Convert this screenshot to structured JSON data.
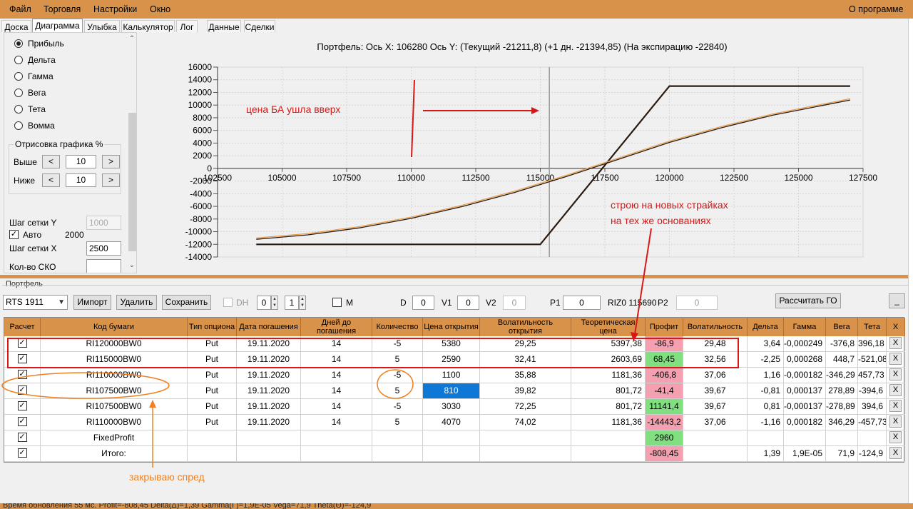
{
  "menu": {
    "file": "Файл",
    "trade": "Торговля",
    "settings": "Настройки",
    "window": "Окно",
    "about": "О программе"
  },
  "tabs": [
    "Доска",
    "Диаграмма",
    "Улыбка",
    "Калькулятор",
    "Лог",
    "Данные",
    "Сделки"
  ],
  "left_panel": {
    "radios": [
      "Прибыль",
      "Дельта",
      "Гамма",
      "Вега",
      "Тета",
      "Вомма"
    ],
    "selected_radio": "Прибыль",
    "group_title": "Отрисовка графика %",
    "above_label": "Выше",
    "above_value": "10",
    "below_label": "Ниже",
    "below_value": "10",
    "grid_y_label": "Шаг сетки Y",
    "grid_y_value": "1000",
    "auto_label": "Авто",
    "auto_value": "2000",
    "grid_x_label": "Шаг сетки X",
    "grid_x_value": "2500",
    "sko_label": "Кол-во СКО",
    "sko_value": ""
  },
  "chart": {
    "title": "Портфель: Ось X: 106280 Ось Y:  (Текущий -21211,8)  (+1 дн. -21394,85)  (На экспирацию -22840)",
    "annotation_up": "цена БА ушла вверх",
    "annotation_strikes_1": "строю  на новых страйках",
    "annotation_strikes_2": "на тех же основаниях"
  },
  "chart_data": {
    "type": "line",
    "title": "Портфель: Ось X: 106280 Ось Y:  (Текущий -21211,8)  (+1 дн. -21394,85)  (На экспирацию -22840)",
    "xlim": [
      102500,
      127500
    ],
    "ylim": [
      -14000,
      16000
    ],
    "x_ticks": [
      102500,
      105000,
      107500,
      110000,
      112500,
      115000,
      117500,
      120000,
      122500,
      125000,
      127500
    ],
    "y_ticks": [
      16000,
      14000,
      12000,
      10000,
      8000,
      6000,
      4000,
      2000,
      0,
      -2000,
      -4000,
      -6000,
      -8000,
      -10000,
      -12000,
      -14000
    ],
    "cursor_x": 115350,
    "series": [
      {
        "color": "#2a1a10",
        "x": [
          104000,
          115000,
          120000,
          127000
        ],
        "y": [
          -12000,
          -12000,
          13000,
          13000
        ]
      },
      {
        "color": "#e8a050",
        "x": [
          104000,
          106000,
          108000,
          110000,
          112000,
          114000,
          116000,
          118000,
          120000,
          122000,
          124000,
          126000,
          127000
        ],
        "y": [
          -11000,
          -10300,
          -9200,
          -7700,
          -5800,
          -3600,
          -1100,
          1600,
          4300,
          6600,
          8600,
          10200,
          11000
        ]
      },
      {
        "color": "#2a1a10",
        "x": [
          104000,
          106000,
          108000,
          110000,
          112000,
          114000,
          116000,
          118000,
          120000,
          122000,
          124000,
          126000,
          127000
        ],
        "y": [
          -11200,
          -10500,
          -9400,
          -7900,
          -6000,
          -3800,
          -1300,
          1400,
          4100,
          6400,
          8400,
          10000,
          10800
        ]
      }
    ]
  },
  "portfolio": {
    "label": "Портфель",
    "instrument": "RTS 1911",
    "import_btn": "Импорт",
    "delete_btn": "Удалить",
    "save_btn": "Сохранить",
    "dh_label": "DH",
    "spin1": "0",
    "spin2": "1",
    "m_label": "M",
    "d_label": "D",
    "d_value": "0",
    "v1_label": "V1",
    "v1_value": "0",
    "v2_label": "V2",
    "v2_value": "0",
    "p1_label": "P1",
    "p1_value": "0",
    "riz_label": "RIZ0 115690",
    "p2_label": "P2",
    "p2_value": "0",
    "calc_go_btn": "Рассчитать ГО",
    "minimize_btn": "_"
  },
  "table": {
    "headers": [
      "Расчет",
      "Код бумаги",
      "Тип опциона",
      "Дата погашения",
      "Дней до погашения",
      "Количество",
      "Цена открытия",
      "Волатильность открытия",
      "Теоретическая цена",
      "Профит",
      "Волатильность",
      "Дельта",
      "Гамма",
      "Вега",
      "Тета",
      "X"
    ],
    "rows": [
      {
        "check": "✓",
        "code": "RI120000BW0",
        "type": "Put",
        "date": "19.11.2020",
        "days": "14",
        "qty": "-5",
        "open": "5380",
        "vol_open": "29,25",
        "theo": "5397,38",
        "profit": "-86,9",
        "profit_color": "pink",
        "vol": "29,48",
        "delta": "3,64",
        "gamma": "-0,000249",
        "vega": "-376,8",
        "theta": "396,18",
        "x": "X"
      },
      {
        "check": "✓",
        "code": "RI115000BW0",
        "type": "Put",
        "date": "19.11.2020",
        "days": "14",
        "qty": "5",
        "open": "2590",
        "vol_open": "32,41",
        "theo": "2603,69",
        "profit": "68,45",
        "profit_color": "green",
        "vol": "32,56",
        "delta": "-2,25",
        "gamma": "0,000268",
        "vega": "448,7",
        "theta": "-521,08",
        "x": "X"
      },
      {
        "check": "✓",
        "code": "RI110000BW0",
        "type": "Put",
        "date": "19.11.2020",
        "days": "14",
        "qty": "-5",
        "open": "1100",
        "vol_open": "35,88",
        "theo": "1181,36",
        "profit": "-406,8",
        "profit_color": "pink",
        "vol": "37,06",
        "delta": "1,16",
        "gamma": "-0,000182",
        "vega": "-346,29",
        "theta": "457,73",
        "x": "X"
      },
      {
        "check": "✓",
        "code": "RI107500BW0",
        "type": "Put",
        "date": "19.11.2020",
        "days": "14",
        "qty": "5",
        "open": "810",
        "vol_open": "39,82",
        "theo": "801,72",
        "profit": "-41,4",
        "profit_color": "pink",
        "vol": "39,67",
        "delta": "-0,81",
        "gamma": "0,000137",
        "vega": "278,89",
        "theta": "-394,6",
        "x": "X",
        "selected_open": true
      },
      {
        "check": "✓",
        "code": "RI107500BW0",
        "type": "Put",
        "date": "19.11.2020",
        "days": "14",
        "qty": "-5",
        "open": "3030",
        "vol_open": "72,25",
        "theo": "801,72",
        "profit": "11141,4",
        "profit_color": "green",
        "vol": "39,67",
        "delta": "0,81",
        "gamma": "-0,000137",
        "vega": "-278,89",
        "theta": "394,6",
        "x": "X"
      },
      {
        "check": "✓",
        "code": "RI110000BW0",
        "type": "Put",
        "date": "19.11.2020",
        "days": "14",
        "qty": "5",
        "open": "4070",
        "vol_open": "74,02",
        "theo": "1181,36",
        "profit": "-14443,2",
        "profit_color": "pink",
        "vol": "37,06",
        "delta": "-1,16",
        "gamma": "0,000182",
        "vega": "346,29",
        "theta": "-457,73",
        "x": "X"
      },
      {
        "check": "✓",
        "code": "FixedProfit",
        "type": "",
        "date": "",
        "days": "",
        "qty": "",
        "open": "",
        "vol_open": "",
        "theo": "",
        "profit": "2960",
        "profit_color": "green",
        "vol": "",
        "delta": "",
        "gamma": "",
        "vega": "",
        "theta": "",
        "x": "X"
      },
      {
        "check": "✓",
        "code": "Итого:",
        "type": "",
        "date": "",
        "days": "",
        "qty": "",
        "open": "",
        "vol_open": "",
        "theo": "",
        "profit": "-808,45",
        "profit_color": "pink",
        "vol": "",
        "delta": "1,39",
        "gamma": "1,9E-05",
        "vega": "71,9",
        "theta": "-124,9",
        "x": "X"
      }
    ]
  },
  "notes": {
    "close_spread": "закрываю спред"
  },
  "status": {
    "text": "Время обновления 55 мс. Profit=-808,45 Delta(Δ)=1,39 Gamma(Γ)=1,9E-05 Vega=71,9 Theta(Θ)=-124,9"
  },
  "colors": {
    "accent": "#d9924a",
    "annotation_red": "#d81818",
    "annotation_orange": "#f08020",
    "profit_pink": "#f4a0b0",
    "profit_green": "#80e080",
    "selected_blue": "#0f78d7"
  }
}
